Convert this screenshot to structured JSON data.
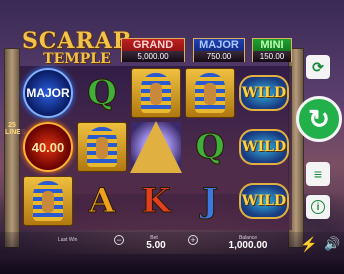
{
  "game": {
    "logo_line1": "SCARAB",
    "logo_line2": "TEMPLE"
  },
  "jackpots": {
    "grand": {
      "name": "GRAND",
      "value": "5,000.00"
    },
    "major": {
      "name": "MAJOR",
      "value": "750.00"
    },
    "mini": {
      "name": "MINI",
      "value": "150.00"
    }
  },
  "ways": "25 LINES",
  "reels": {
    "symbols": [
      [
        "orb-major",
        "orb-value",
        "pharaoh"
      ],
      [
        "q",
        "pharaoh",
        "a"
      ],
      [
        "pharaoh",
        "pyramid",
        "k"
      ],
      [
        "pharaoh",
        "q",
        "j"
      ],
      [
        "wild",
        "wild",
        "wild"
      ]
    ],
    "orb_major_label": "MAJOR",
    "orb_value_label": "40.00",
    "wild_label": "WILD",
    "letters": {
      "q": "Q",
      "a": "A",
      "k": "K",
      "j": "J"
    }
  },
  "controls": {
    "autoplay_icon": "autoplay-icon",
    "spin_icon": "spin-icon",
    "coins_icon": "coins-icon",
    "info_icon": "info-icon",
    "info_glyph": "i",
    "spin_glyph": "↻",
    "autoplay_glyph": "⟳",
    "coins_glyph": "≡"
  },
  "footer": {
    "last_win_label": "Last Win",
    "bet_label": "Bet",
    "bet_value": "5.00",
    "balance_label": "Balance",
    "balance_value": "1,000.00",
    "minus": "−",
    "plus": "+",
    "turbo_glyph": "⚡",
    "sound_glyph": "🔊"
  }
}
